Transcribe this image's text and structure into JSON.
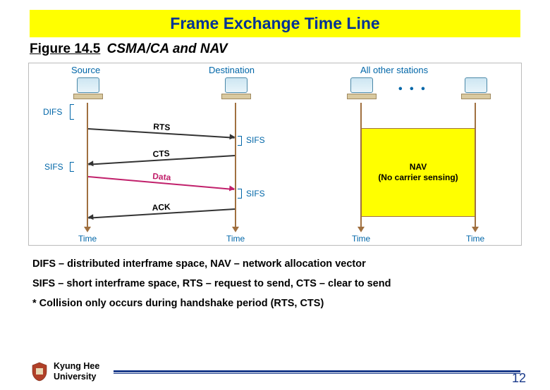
{
  "title": "Frame Exchange Time Line",
  "figure": {
    "ref": "Figure 14.5",
    "caption": "CSMA/CA and NAV"
  },
  "headers": {
    "source": "Source",
    "destination": "Destination",
    "others": "All other stations"
  },
  "side": {
    "difs": "DIFS",
    "sifs_left": "SIFS",
    "sifs_r1": "SIFS",
    "sifs_r2": "SIFS"
  },
  "messages": {
    "rts": "RTS",
    "cts": "CTS",
    "data": "Data",
    "ack": "ACK"
  },
  "nav": {
    "line1": "NAV",
    "line2": "(No carrier sensing)"
  },
  "timeword": "Time",
  "dots": "• • •",
  "notes": {
    "l1": "DIFS – distributed interframe space, NAV – network allocation vector",
    "l2": "SIFS – short interframe space, RTS – request to send, CTS – clear to send",
    "l3": "* Collision only occurs during handshake period (RTS, CTS)"
  },
  "footer": {
    "uni1": "Kyung Hee",
    "uni2": "University",
    "page": "12"
  }
}
